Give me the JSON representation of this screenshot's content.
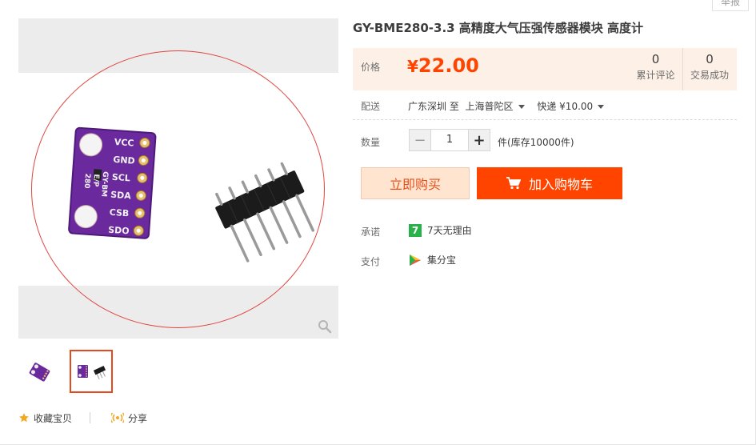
{
  "report": "举报",
  "product": {
    "title": "GY-BME280-3.3 高精度大气压强传感器模块 高度计",
    "board_pins": [
      "VCC",
      "GND",
      "SCL",
      "SDA",
      "CSB",
      "SDO"
    ],
    "board_silk": "GY-BM\nE/P\n280"
  },
  "price": {
    "label": "价格",
    "currency": "¥",
    "value": "22.00",
    "accent": "#ff4400"
  },
  "stats": {
    "reviews_count": "0",
    "reviews_label": "累计评论",
    "deals_count": "0",
    "deals_label": "交易成功"
  },
  "shipping": {
    "label": "配送",
    "from": "广东深圳",
    "to_word": "至",
    "to": "上海普陀区",
    "method": "快递 ¥10.00"
  },
  "quantity": {
    "label": "数量",
    "value": "1",
    "minus": "−",
    "plus": "+",
    "stock": "件(库存10000件)"
  },
  "actions": {
    "buy_now": "立即购买",
    "add_cart": "加入购物车"
  },
  "promise": {
    "label": "承诺",
    "icon_text": "7",
    "text": "7天无理由"
  },
  "payment": {
    "label": "支付",
    "text": "集分宝"
  },
  "social": {
    "favorite": "收藏宝贝",
    "share": "分享"
  }
}
